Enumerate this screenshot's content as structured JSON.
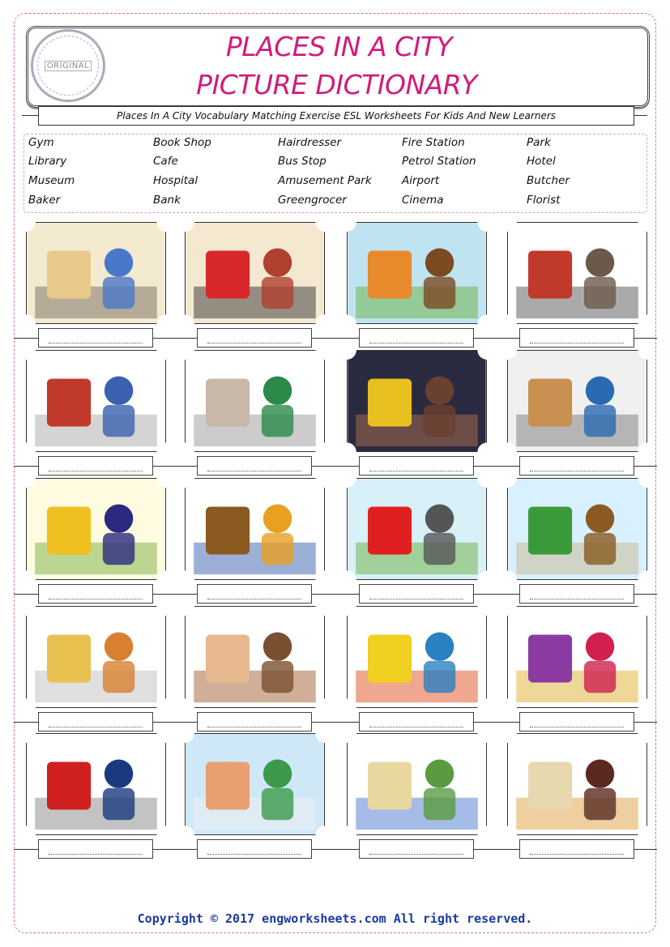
{
  "header": {
    "stamp_text": "ORIGINAL",
    "title_line1": "PLACES IN A CITY",
    "title_line2": "PICTURE DICTIONARY",
    "subtitle": "Places In A City Vocabulary Matching Exercise ESL Worksheets For Kids And New Learners"
  },
  "word_bank": [
    [
      "Gym",
      "Book Shop",
      "Hairdresser",
      "Fire Station",
      "Park"
    ],
    [
      "Library",
      "Cafe",
      "Bus Stop",
      "Petrol Station",
      "Hotel"
    ],
    [
      "Museum",
      "Hospital",
      "Amusement Park",
      "Airport",
      "Butcher"
    ],
    [
      "Baker",
      "Bank",
      "Greengrocer",
      "Cinema",
      "Florist"
    ]
  ],
  "pictures": [
    "hairdresser",
    "fire-station",
    "greengrocer",
    "bus-stop",
    "florist",
    "museum",
    "cinema",
    "book-shop",
    "cafe",
    "library",
    "airport",
    "park",
    "baker",
    "butcher",
    "gym",
    "amusement-park",
    "petrol-station",
    "hotel",
    "hospital",
    "bank"
  ],
  "colors": {
    "title": "#d01c7c",
    "footer": "#1a3aa0",
    "border": "#d070a8"
  },
  "footer": "Copyright © 2017 engworksheets.com All right reserved."
}
